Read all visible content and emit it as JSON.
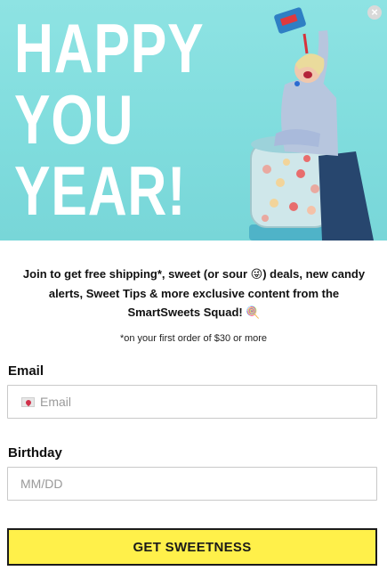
{
  "hero": {
    "headline_lines": [
      "HAPPY",
      "YOU",
      "YEAR!"
    ],
    "colors": {
      "background": "#8ee3e3",
      "headline": "#ffffff"
    },
    "image_icon": "woman-eating-candy-photo"
  },
  "close": {
    "label": "×",
    "icon": "close-icon"
  },
  "intro": {
    "part1": "Join to get free shipping*, sweet (or sour ",
    "emoji1": "😜",
    "part2": ") deals, new candy alerts, Sweet Tips & more exclusive content from the SmartSweets Squad! ",
    "emoji2": "🍭"
  },
  "fineprint": "*on your first order of $30 or more",
  "form": {
    "email_label": "Email",
    "email_placeholder": "Email",
    "email_value": "",
    "email_icon": "love-letter-icon",
    "birthday_label": "Birthday",
    "birthday_placeholder": "MM/DD",
    "birthday_value": ""
  },
  "submit": {
    "label": "GET SWEETNESS",
    "color": "#fff04a"
  }
}
